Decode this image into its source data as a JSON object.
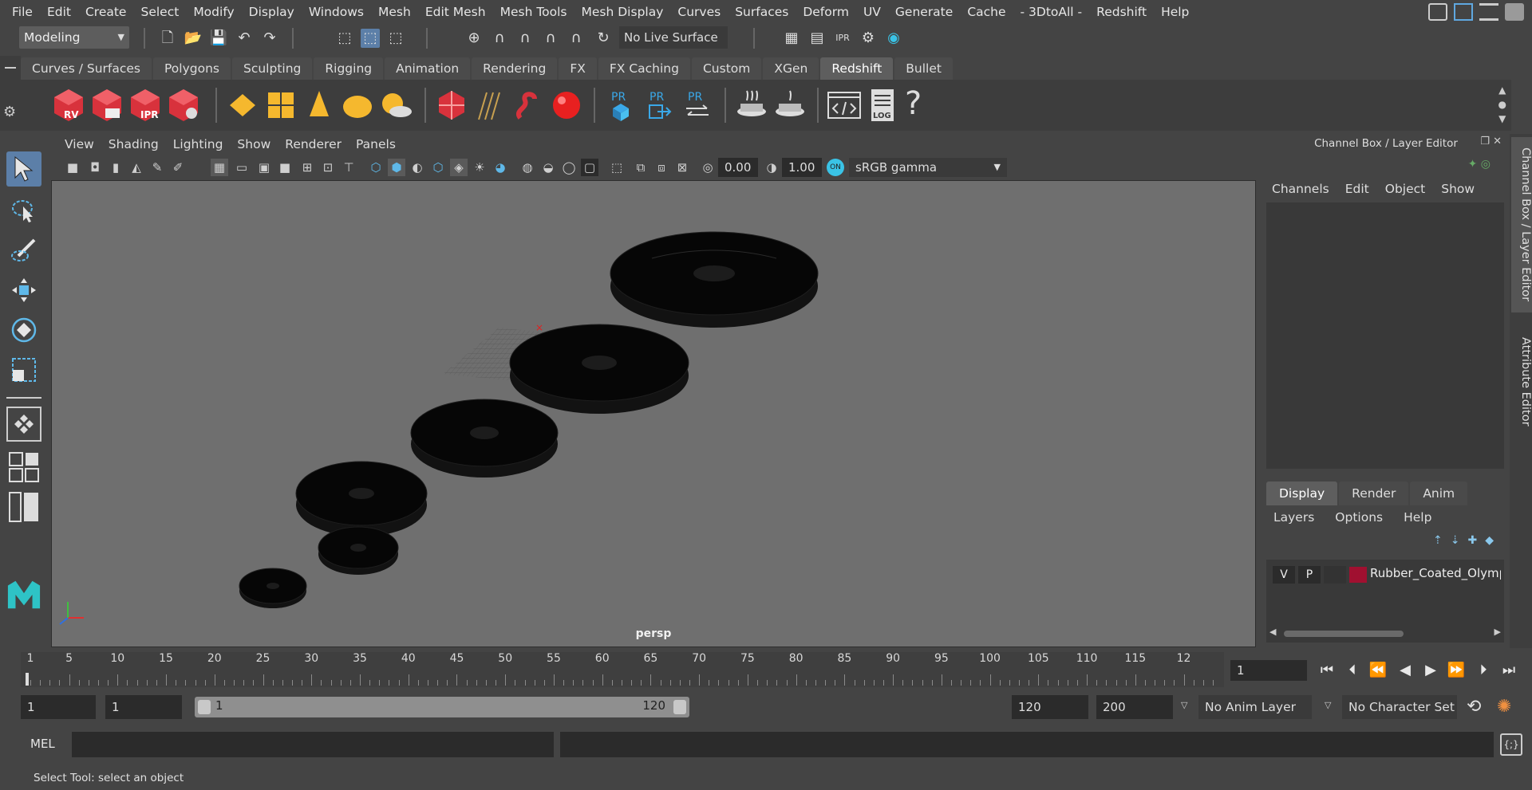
{
  "menubar": [
    "File",
    "Edit",
    "Create",
    "Select",
    "Modify",
    "Display",
    "Windows",
    "Mesh",
    "Edit Mesh",
    "Mesh Tools",
    "Mesh Display",
    "Curves",
    "Surfaces",
    "Deform",
    "UV",
    "Generate",
    "Cache",
    "- 3DtoAll -",
    "Redshift",
    "Help"
  ],
  "status": {
    "mode": "Modeling",
    "live_surface": "No Live Surface"
  },
  "shelf": {
    "tabs": [
      "Curves / Surfaces",
      "Polygons",
      "Sculpting",
      "Rigging",
      "Animation",
      "Rendering",
      "FX",
      "FX Caching",
      "Custom",
      "XGen",
      "Redshift",
      "Bullet"
    ],
    "active_tab": "Redshift",
    "icon_labels": {
      "rv": "RV",
      "ipr": "IPR",
      "pr": "PR",
      "log": "LOG",
      "help": "?"
    }
  },
  "viewport": {
    "menu": [
      "View",
      "Shading",
      "Lighting",
      "Show",
      "Renderer",
      "Panels"
    ],
    "exposure": "0.00",
    "gamma": "1.00",
    "color_space": "sRGB gamma",
    "camera": "persp"
  },
  "right_panel": {
    "title": "Channel Box / Layer Editor",
    "menu": [
      "Channels",
      "Edit",
      "Object",
      "Show"
    ],
    "tabs": [
      "Display",
      "Render",
      "Anim"
    ],
    "layer_menu": [
      "Layers",
      "Options",
      "Help"
    ],
    "layer": {
      "v": "V",
      "p": "P",
      "name": "Rubber_Coated_Olymp",
      "color": "#a01030"
    },
    "vertical_tabs": [
      "Channel Box / Layer Editor",
      "Attribute Editor"
    ]
  },
  "timeline": {
    "tick_labels": [
      "1",
      "5",
      "10",
      "15",
      "20",
      "25",
      "30",
      "35",
      "40",
      "45",
      "50",
      "55",
      "60",
      "65",
      "70",
      "75",
      "80",
      "85",
      "90",
      "95",
      "100",
      "105",
      "110",
      "115",
      "12"
    ],
    "current_frame": "1"
  },
  "range": {
    "start": "1",
    "playback_start": "1",
    "slider_start": "1",
    "slider_end": "120",
    "playback_end": "120",
    "end": "200",
    "anim_layer": "No Anim Layer",
    "character_set": "No Character Set"
  },
  "command": {
    "label": "MEL"
  },
  "help_line": "Select Tool: select an object",
  "colors": {
    "accent": "#5c7fa8",
    "redshift_red": "#d8323c",
    "gold": "#f5b82e",
    "pr_blue": "#3aa8e8"
  }
}
